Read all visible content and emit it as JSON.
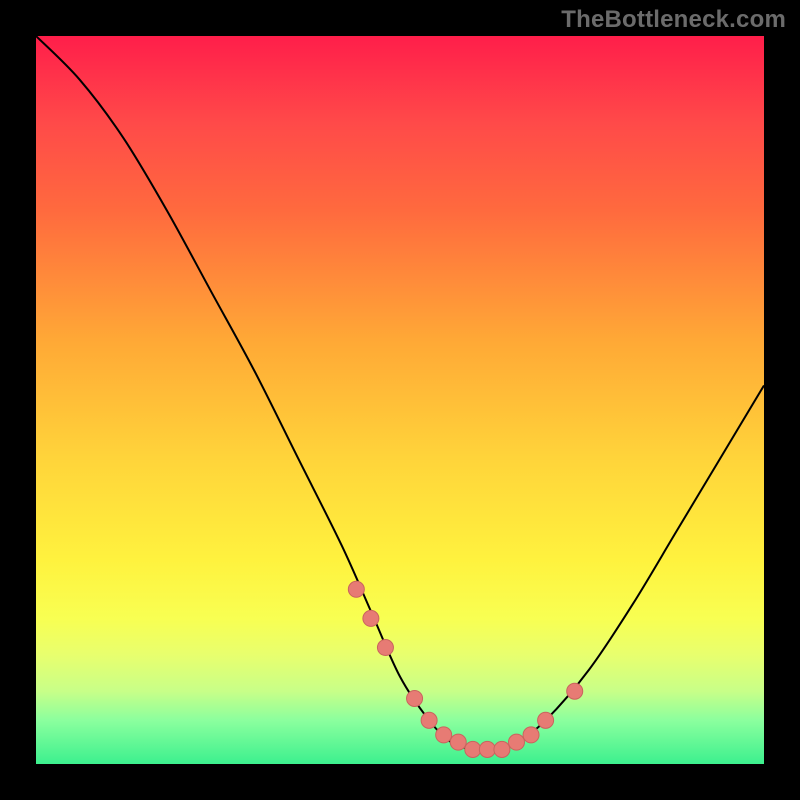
{
  "watermark": "TheBottleneck.com",
  "colors": {
    "frame": "#000000",
    "gradient_top": "#ff1e4a",
    "gradient_bottom": "#3cf08e",
    "curve": "#000000",
    "dot_fill": "#e77b74",
    "dot_stroke": "#c9645e"
  },
  "chart_data": {
    "type": "line",
    "title": "",
    "xlabel": "",
    "ylabel": "",
    "xlim": [
      0,
      100
    ],
    "ylim": [
      0,
      100
    ],
    "x": [
      0,
      6,
      12,
      18,
      24,
      30,
      36,
      42,
      46,
      50,
      54,
      57,
      60,
      63,
      66,
      70,
      76,
      82,
      88,
      94,
      100
    ],
    "values": [
      100,
      94,
      86,
      76,
      65,
      54,
      42,
      30,
      21,
      12,
      6,
      3,
      2,
      2,
      3,
      6,
      13,
      22,
      32,
      42,
      52
    ],
    "highlight_points": {
      "x": [
        44,
        46,
        48,
        52,
        54,
        56,
        58,
        60,
        62,
        64,
        66,
        68,
        70,
        74
      ],
      "values": [
        24,
        20,
        16,
        9,
        6,
        4,
        3,
        2,
        2,
        2,
        3,
        4,
        6,
        10
      ]
    },
    "dot_radius_pct": 1.1
  }
}
